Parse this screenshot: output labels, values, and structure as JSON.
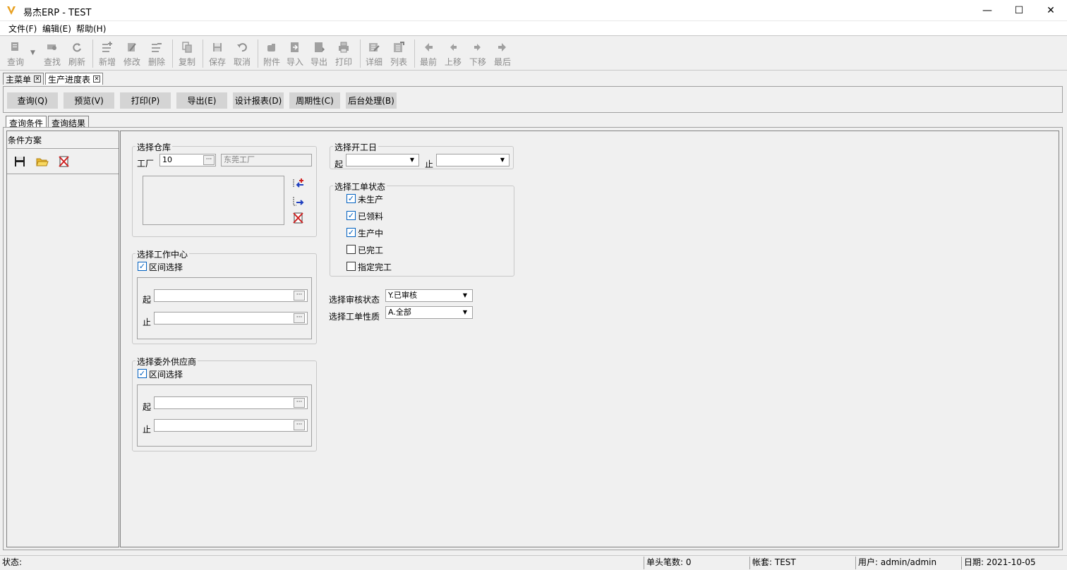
{
  "window": {
    "title": "易杰ERP - TEST",
    "controls": [
      "—",
      "☐",
      "✕"
    ]
  },
  "menu": [
    "文件(F)",
    "编辑(E)",
    "帮助(H)"
  ],
  "toolbar": [
    {
      "label": "查询",
      "icon": "query-icon"
    },
    {
      "label": "查找",
      "icon": "find-icon"
    },
    {
      "label": "刷新",
      "icon": "refresh-icon"
    },
    {
      "label": "新增",
      "icon": "add-icon"
    },
    {
      "label": "修改",
      "icon": "edit-icon"
    },
    {
      "label": "删除",
      "icon": "delete-icon"
    },
    {
      "label": "复制",
      "icon": "copy-icon"
    },
    {
      "label": "保存",
      "icon": "save-icon"
    },
    {
      "label": "取消",
      "icon": "undo-icon"
    },
    {
      "label": "附件",
      "icon": "attachment-icon"
    },
    {
      "label": "导入",
      "icon": "import-icon"
    },
    {
      "label": "导出",
      "icon": "export-icon"
    },
    {
      "label": "打印",
      "icon": "print-icon"
    },
    {
      "label": "详细",
      "icon": "detail-icon"
    },
    {
      "label": "列表",
      "icon": "list-icon"
    },
    {
      "label": "最前",
      "icon": "first-icon"
    },
    {
      "label": "上移",
      "icon": "prev-icon"
    },
    {
      "label": "下移",
      "icon": "next-icon"
    },
    {
      "label": "最后",
      "icon": "last-icon"
    }
  ],
  "doc_tabs": [
    "主菜单",
    "生产进度表"
  ],
  "actions": [
    "查询(Q)",
    "预览(V)",
    "打印(P)",
    "导出(E)",
    "设计报表(D)",
    "周期性(C)",
    "后台处理(B)"
  ],
  "sub_tabs": [
    "查询条件",
    "查询结果"
  ],
  "left_panel": {
    "title": "条件方案"
  },
  "warehouse": {
    "title": "选择仓库",
    "factory_label": "工厂",
    "factory_code": "10",
    "factory_name": "东莞工厂",
    "dots": "···"
  },
  "workcenter": {
    "title": "选择工作中心",
    "range_label": "区间选择",
    "from_label": "起",
    "to_label": "止"
  },
  "supplier": {
    "title": "选择委外供应商",
    "range_label": "区间选择",
    "from_label": "起",
    "to_label": "止"
  },
  "start_date": {
    "title": "选择开工日",
    "from_label": "起",
    "to_label": "止"
  },
  "order_status": {
    "title": "选择工单状态",
    "items": [
      {
        "label": "未生产",
        "checked": true
      },
      {
        "label": "已领料",
        "checked": true
      },
      {
        "label": "生产中",
        "checked": true
      },
      {
        "label": "已完工",
        "checked": false
      },
      {
        "label": "指定完工",
        "checked": false
      }
    ]
  },
  "audit": {
    "label": "选择审核状态",
    "value": "Y.已审核"
  },
  "nature": {
    "label": "选择工单性质",
    "value": "A.全部"
  },
  "statusbar": {
    "status": "状态:",
    "count": "单头笔数: 0",
    "account": "帐套: TEST",
    "user": "用户: admin/admin",
    "date": "日期: 2021-10-05"
  },
  "colors": {
    "checkbox": "#0060c0",
    "button": "#d4d4d4",
    "logo": "#e8a020"
  }
}
